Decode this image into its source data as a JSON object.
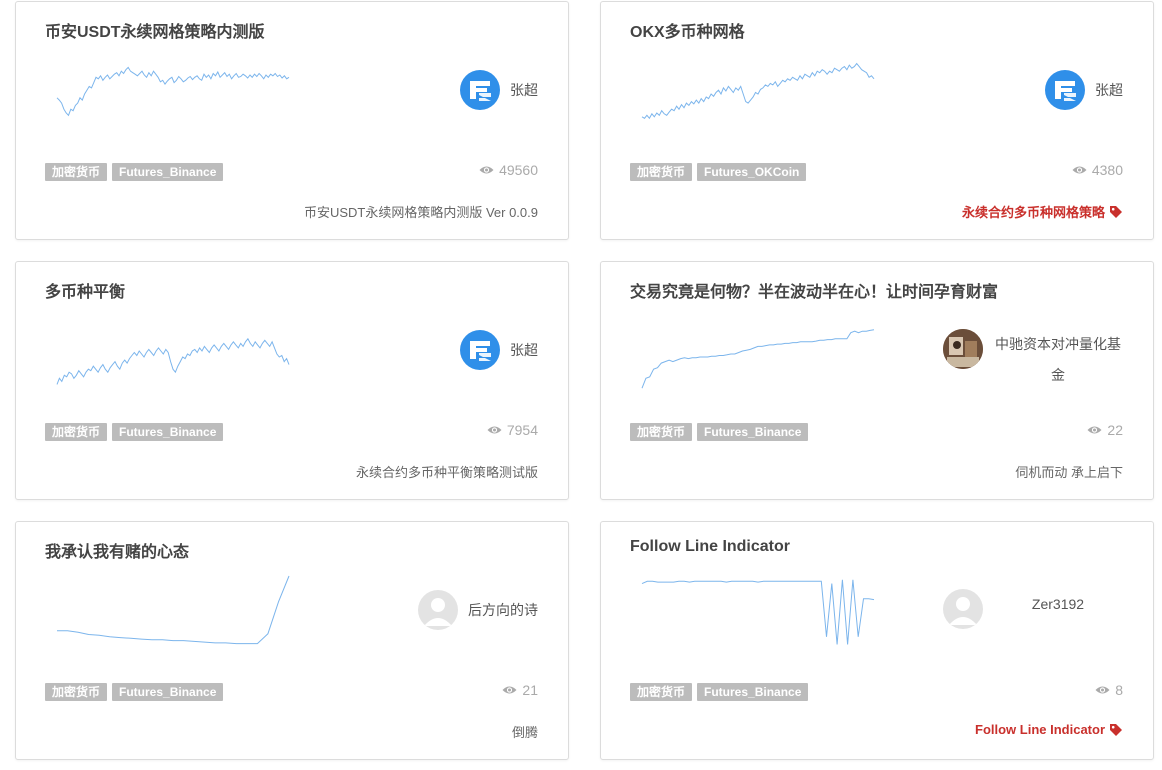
{
  "cards": [
    {
      "title": "币安USDT永续网格策略内测版",
      "author": "张超",
      "avatar": "fmz-logo-icon",
      "tags": [
        "加密货币",
        "Futures_Binance"
      ],
      "views": "49560",
      "footer": "币安USDT永续网格策略内测版 Ver 0.0.9",
      "footer_style": "plain",
      "chart_data": {
        "type": "line",
        "ylim": [
          0,
          100
        ],
        "values": [
          45,
          42,
          38,
          30,
          25,
          22,
          30,
          28,
          35,
          38,
          45,
          42,
          50,
          55,
          60,
          58,
          65,
          72,
          70,
          74,
          68,
          72,
          75,
          70,
          73,
          76,
          78,
          74,
          80,
          77,
          82,
          85,
          80,
          78,
          76,
          74,
          77,
          80,
          75,
          72,
          78,
          74,
          80,
          76,
          72,
          66,
          68,
          63,
          67,
          70,
          72,
          65,
          68,
          73,
          70,
          66,
          68,
          71,
          73,
          69,
          72,
          74,
          70,
          68,
          76,
          72,
          75,
          70,
          77,
          74,
          79,
          72,
          75,
          78,
          73,
          76,
          70,
          74,
          77,
          72,
          73,
          76,
          74,
          71,
          75,
          72,
          76,
          73,
          77,
          74,
          70,
          75,
          72,
          76,
          74,
          77,
          73,
          75,
          71,
          74,
          70,
          72
        ]
      }
    },
    {
      "title": "OKX多币种网格",
      "author": "张超",
      "avatar": "fmz-logo-icon",
      "tags": [
        "加密货币",
        "Futures_OKCoin"
      ],
      "views": "4380",
      "footer": "永续合约多币种网格策略",
      "footer_style": "link",
      "chart_data": {
        "type": "line",
        "ylim": [
          0,
          100
        ],
        "values": [
          20,
          18,
          22,
          18,
          24,
          20,
          25,
          22,
          28,
          24,
          22,
          26,
          30,
          28,
          34,
          30,
          36,
          32,
          38,
          35,
          40,
          37,
          42,
          38,
          44,
          40,
          46,
          44,
          50,
          47,
          52,
          55,
          50,
          58,
          54,
          60,
          56,
          52,
          58,
          55,
          60,
          50,
          40,
          38,
          42,
          46,
          52,
          50,
          56,
          58,
          62,
          60,
          64,
          62,
          66,
          60,
          64,
          68,
          66,
          70,
          68,
          72,
          70,
          68,
          74,
          70,
          76,
          74,
          72,
          78,
          74,
          80,
          78,
          82,
          80,
          76,
          80,
          78,
          84,
          82,
          80,
          84,
          86,
          82,
          88,
          84,
          86,
          90,
          86,
          82,
          80,
          78,
          72,
          74,
          70
        ]
      }
    },
    {
      "title": "多币种平衡",
      "author": "张超",
      "avatar": "fmz-logo-icon",
      "tags": [
        "加密货币",
        "Futures_Binance"
      ],
      "views": "7954",
      "footer": "永续合约多币种平衡策略测试版",
      "footer_style": "plain",
      "chart_data": {
        "type": "line",
        "ylim": [
          0,
          100
        ],
        "values": [
          10,
          18,
          14,
          22,
          20,
          26,
          24,
          18,
          22,
          28,
          24,
          20,
          26,
          30,
          28,
          34,
          30,
          26,
          32,
          36,
          30,
          26,
          32,
          36,
          40,
          34,
          30,
          38,
          42,
          38,
          44,
          48,
          52,
          48,
          54,
          50,
          46,
          52,
          56,
          52,
          48,
          54,
          58,
          54,
          50,
          56,
          52,
          40,
          30,
          26,
          34,
          40,
          46,
          44,
          50,
          48,
          54,
          56,
          52,
          58,
          54,
          60,
          56,
          52,
          58,
          62,
          58,
          54,
          60,
          64,
          60,
          56,
          62,
          66,
          62,
          58,
          64,
          60,
          66,
          70,
          64,
          60,
          66,
          62,
          58,
          64,
          68,
          64,
          60,
          66,
          58,
          50,
          46,
          48,
          40,
          44,
          36
        ]
      }
    },
    {
      "title": "交易究竟是何物？半在波动半在心！让时间孕育财富",
      "author": "中驰资本对冲量化基金",
      "avatar": "photo-avatar-icon",
      "tags": [
        "加密货币",
        "Futures_Binance"
      ],
      "views": "22",
      "footer": "伺机而动 承上启下",
      "footer_style": "plain",
      "chart_data": {
        "type": "line",
        "ylim": [
          0,
          100
        ],
        "values": [
          5,
          18,
          20,
          30,
          32,
          38,
          40,
          42,
          40,
          42,
          44,
          45,
          44,
          45,
          45,
          46,
          46,
          46,
          47,
          47,
          48,
          48,
          49,
          50,
          50,
          52,
          54,
          55,
          56,
          58,
          60,
          60,
          61,
          62,
          62,
          63,
          63,
          64,
          64,
          65,
          65,
          66,
          66,
          66,
          66,
          67,
          68,
          68,
          69,
          69,
          70,
          70,
          70,
          70,
          78,
          80,
          78,
          80,
          80,
          81,
          82
        ]
      }
    },
    {
      "title": "我承认我有赌的心态",
      "author": "后方向的诗",
      "avatar": "default-user-icon",
      "tags": [
        "加密货币",
        "Futures_Binance"
      ],
      "views": "21",
      "footer": "倒腾",
      "footer_style": "plain",
      "chart_data": {
        "type": "line",
        "ylim": [
          0,
          100
        ],
        "values": [
          28,
          28,
          26,
          23,
          22,
          20,
          19,
          18,
          17,
          16,
          16,
          15,
          15,
          14,
          13,
          12,
          12,
          11,
          11,
          11,
          24,
          66,
          100
        ]
      }
    },
    {
      "title": "Follow Line Indicator",
      "author": "Zer3192",
      "avatar": "default-user-icon",
      "tags": [
        "加密货币",
        "Futures_Binance"
      ],
      "views": "8",
      "footer": "Follow Line Indicator",
      "footer_style": "link",
      "chart_data": {
        "type": "line",
        "ylim": [
          0,
          100
        ],
        "values": [
          90,
          93,
          93,
          92,
          92,
          92,
          92,
          93,
          93,
          92,
          93,
          93,
          93,
          93,
          93,
          93,
          92,
          93,
          93,
          93,
          93,
          93,
          92,
          93,
          93,
          93,
          93,
          93,
          93,
          93,
          93,
          93,
          93,
          93,
          93,
          20,
          90,
          10,
          95,
          10,
          95,
          20,
          70,
          70,
          69
        ]
      }
    }
  ],
  "colors": {
    "line": "#7cb5ec",
    "tag_bg": "#bcbcbc",
    "link": "#c9302c",
    "logo_bg": "#2f8fe9"
  }
}
